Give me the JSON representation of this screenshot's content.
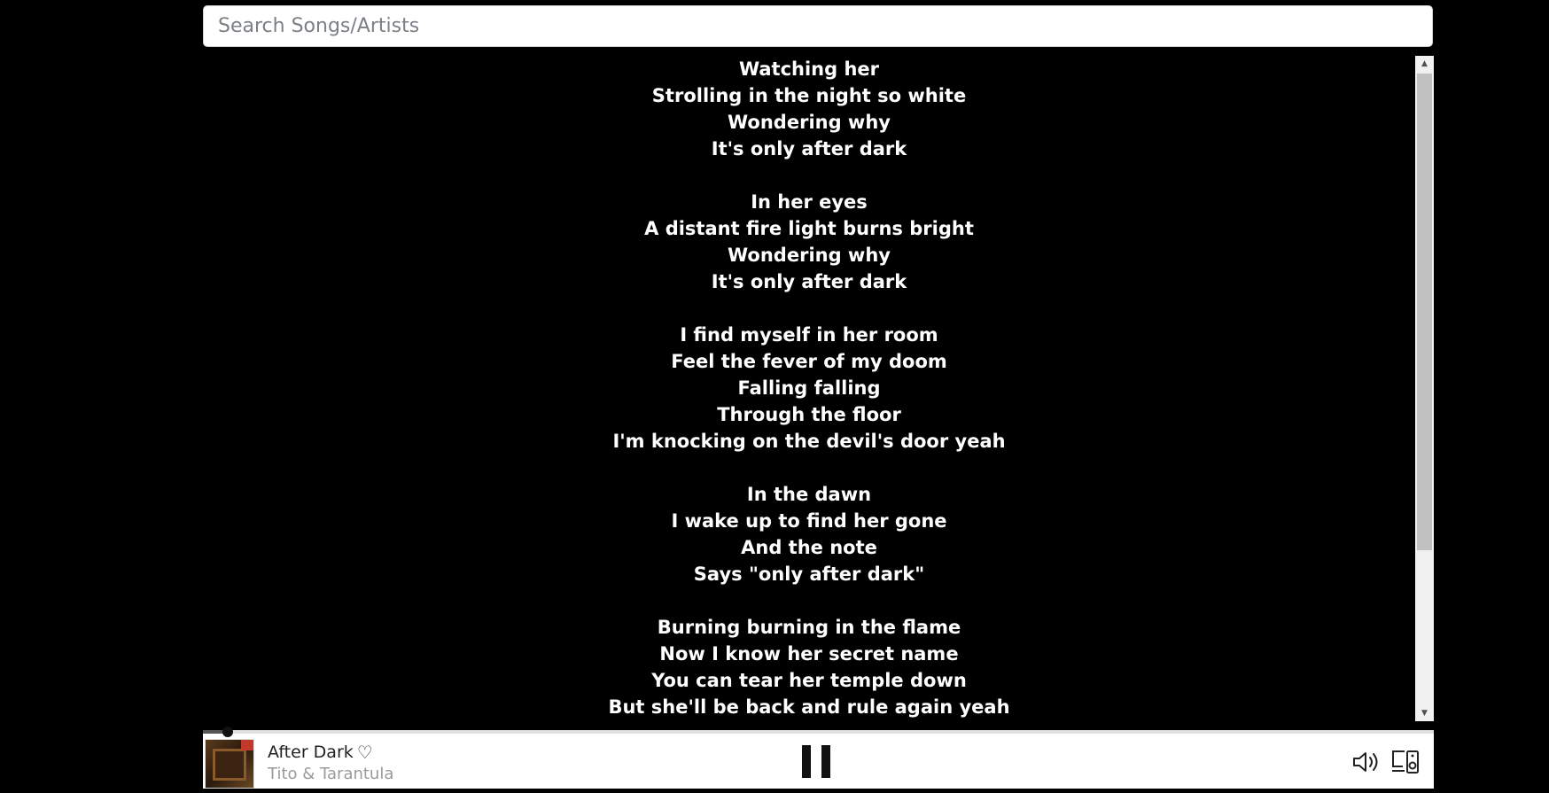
{
  "search": {
    "placeholder": "Search Songs/Artists",
    "value": ""
  },
  "lyrics": {
    "lines": [
      "Watching her",
      "Strolling in the night so white",
      "Wondering why",
      "It's only after dark",
      "",
      "In her eyes",
      "A distant fire light burns bright",
      "Wondering why",
      "It's only after dark",
      "",
      "I find myself in her room",
      "Feel the fever of my doom",
      "Falling falling",
      "Through the floor",
      "I'm knocking on the devil's door yeah",
      "",
      "In the dawn",
      "I wake up to find her gone",
      "And the note",
      "Says \"only after dark\"",
      "",
      "Burning burning in the flame",
      "Now I know her secret name",
      "You can tear her temple down",
      "But she'll be back and rule again yeah"
    ]
  },
  "player": {
    "track_title": "After Dark",
    "artist": "Tito & Tarantula",
    "progress": 0.02,
    "heart_icon": "heart-outline-icon",
    "play_state_icon": "pause-icon",
    "volume_icon": "speaker-icon",
    "devices_icon": "devices-icon"
  },
  "colors": {
    "background": "#000000",
    "lyrics_text": "#ffffff",
    "player_background": "#ffffff",
    "artist_text": "#9a9a9a"
  }
}
